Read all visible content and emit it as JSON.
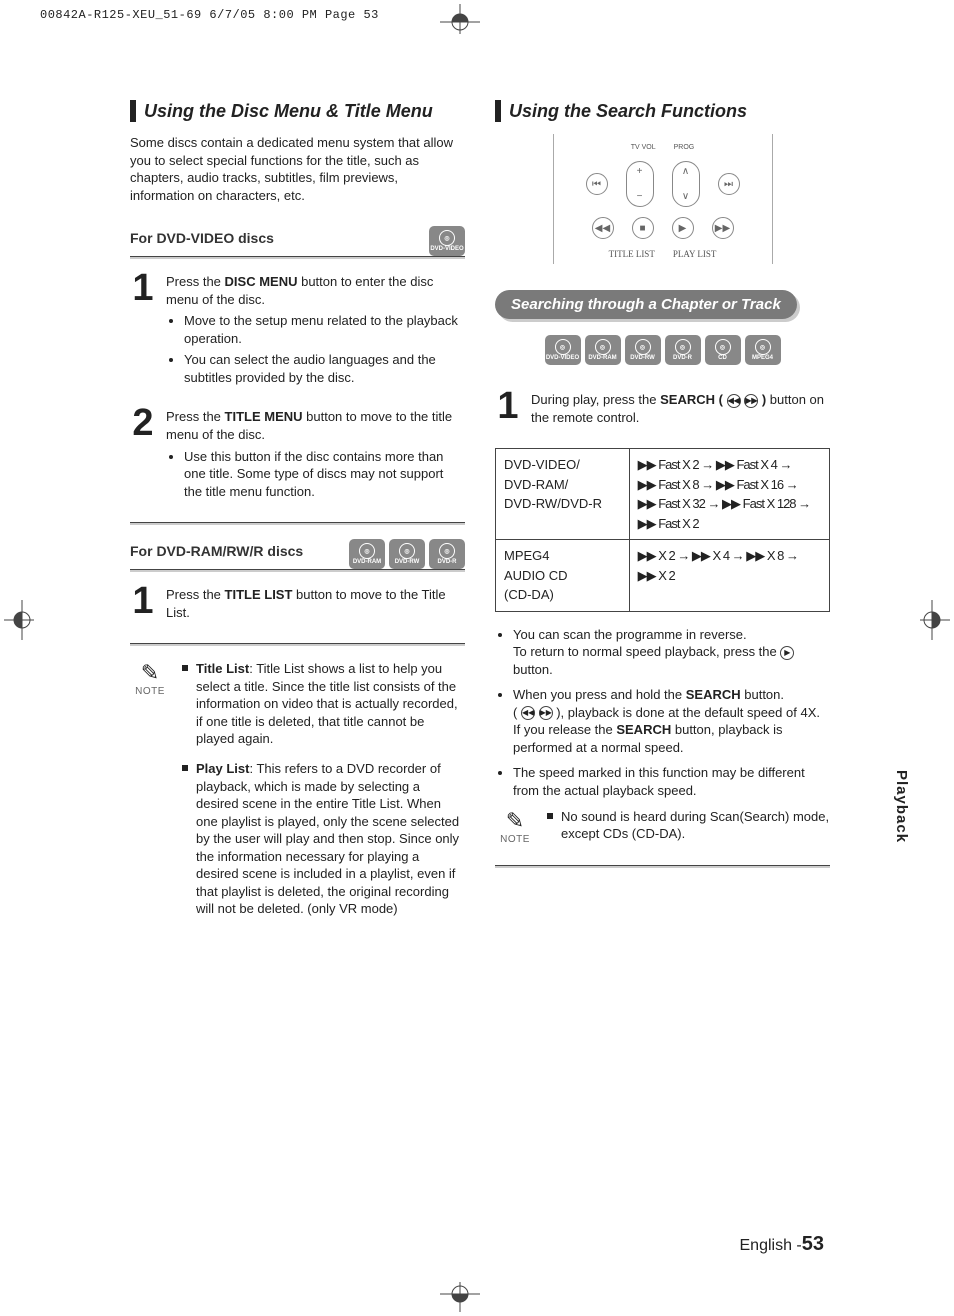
{
  "print_header": "00842A-R125-XEU_51-69  6/7/05  8:00 PM  Page 53",
  "side_tab": "Playback",
  "page_footer_lang": "English -",
  "page_footer_num": "53",
  "left": {
    "title": "Using the Disc Menu & Title Menu",
    "intro": "Some discs contain a dedicated menu system that allow you to select special functions for the title, such as chapters, audio tracks, subtitles, film previews, information on characters, etc.",
    "sub1": "For DVD-VIDEO discs",
    "sub1_badges": [
      "DVD-VIDEO"
    ],
    "step1_lead_a": "Press the ",
    "step1_lead_bold": "DISC MENU",
    "step1_lead_b": " button to enter the disc menu of the disc.",
    "step1_b1": "Move to the setup menu related to the playback operation.",
    "step1_b2": "You can select the audio languages and the subtitles provided by the disc.",
    "step2_lead_a": "Press the ",
    "step2_lead_bold": "TITLE MENU",
    "step2_lead_b": " button to move to the title menu of the disc.",
    "step2_b1": "Use this button if the disc contains more than one title. Some type of discs may not support the title menu function.",
    "sub2": "For DVD-RAM/RW/R discs",
    "sub2_badges": [
      "DVD-RAM",
      "DVD-RW",
      "DVD-R"
    ],
    "step3_lead_a": "Press the ",
    "step3_lead_bold": "TITLE LIST",
    "step3_lead_b": " button to move to the Title List.",
    "note_label": "NOTE",
    "note1_label": "Title List",
    "note1_body": ": Title List shows a list to help you select a title. Since the title list consists of the information on video that is actually recorded, if one title is deleted, that title cannot be played again.",
    "note2_label": "Play List",
    "note2_body": ": This refers to a DVD recorder of playback, which is made by selecting a desired scene in the entire Title List. When one playlist is played, only the scene selected by the user will play and then stop. Since only the information necessary for playing a desired scene is included in a playlist, even if that playlist is deleted, the original recording will not be deleted. (only VR mode)"
  },
  "right": {
    "title": "Using the Search Functions",
    "diagram_labels": {
      "tvvol": "TV VOL",
      "prog": "PROG",
      "title": "TITLE LIST",
      "play": "PLAY LIST"
    },
    "pill": "Searching through a Chapter or Track",
    "badges": [
      "DVD-VIDEO",
      "DVD-RAM",
      "DVD-RW",
      "DVD-R",
      "CD",
      "MPEG4"
    ],
    "step1_a": "During play, press the ",
    "step1_bold": "SEARCH (",
    "step1_b": ")",
    "step1_c": " button on the remote control.",
    "table_left1": "DVD-VIDEO/",
    "table_left2": "DVD-RAM/",
    "table_left3": "DVD-RW/DVD-R",
    "table_right1": "▶▶ Fast X 2 → ▶▶ Fast X 4 →",
    "table_right2": "▶▶ Fast X 8 → ▶▶ Fast X 16 →",
    "table_right3": "▶▶ Fast X 32 → ▶▶ Fast X 128 →",
    "table_right4": "▶▶ Fast X 2",
    "table_left4": "MPEG4",
    "table_left5": "AUDIO CD",
    "table_left6": "(CD-DA)",
    "table_right5": "▶▶ X 2 → ▶▶ X 4 → ▶▶ X 8 →",
    "table_right6": "▶▶ X 2",
    "bul1a": "You can scan the programme in reverse.",
    "bul1b_a": "To return to normal speed playback, press the ",
    "bul1b_b": " button.",
    "bul2a_a": "When you press and hold the ",
    "bul2a_bold": "SEARCH",
    "bul2a_b": " button.",
    "bul2b_a": "( ",
    "bul2b_b": " ), playback is done at the default speed of 4X. If you release the ",
    "bul2b_bold": "SEARCH",
    "bul2b_c": " button, playback is performed at a normal speed.",
    "bul3": "The speed marked in this function may be different from the actual playback speed.",
    "note_label": "NOTE",
    "note1": "No sound is heard during Scan(Search) mode, except CDs (CD-DA)."
  }
}
